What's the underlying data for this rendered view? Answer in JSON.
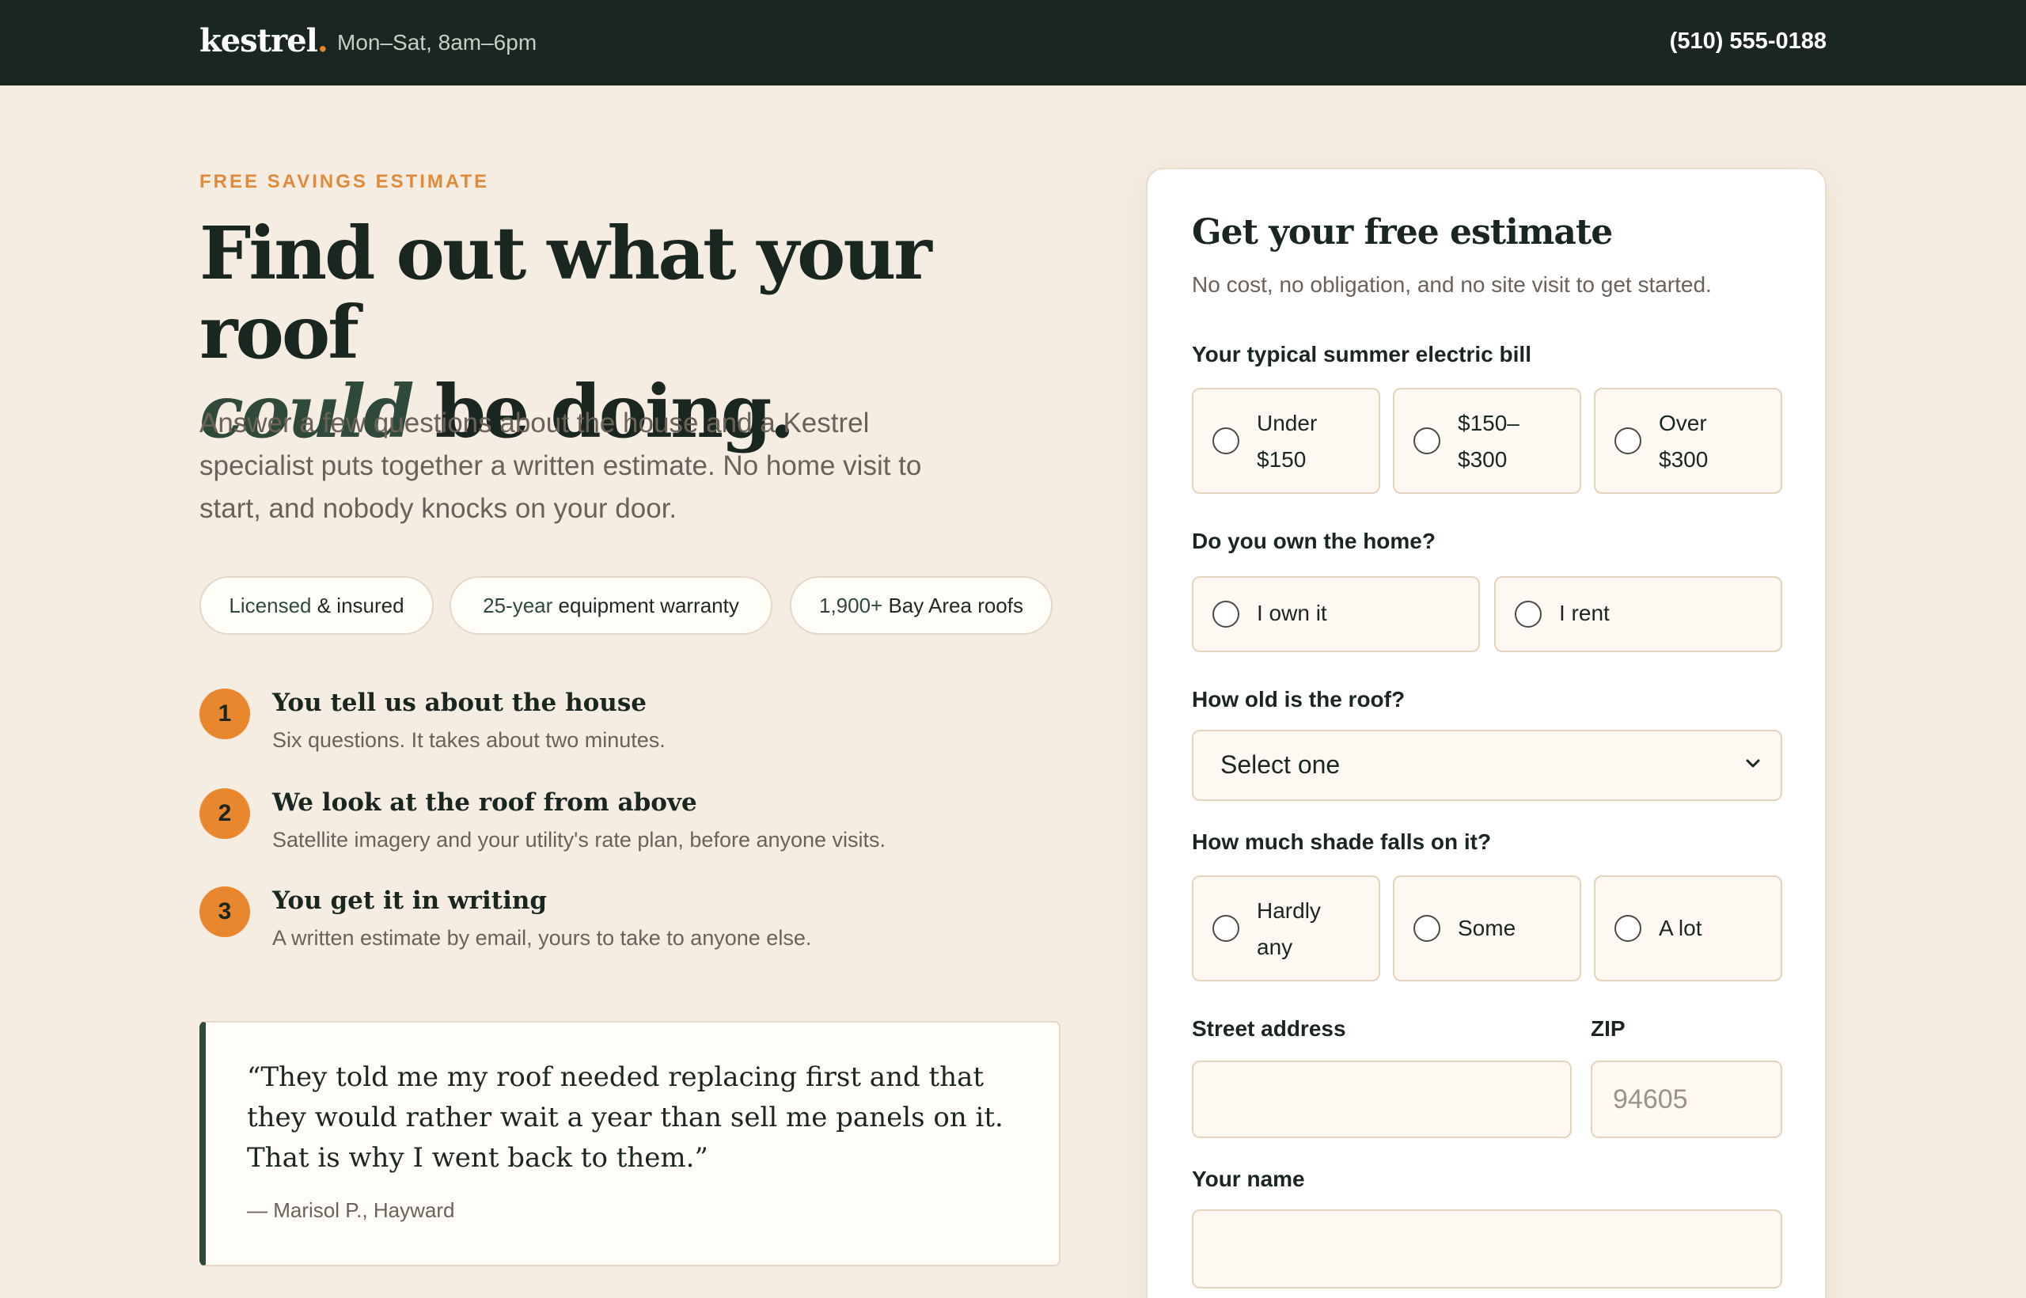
{
  "header": {
    "logo_text": "kestrel",
    "logo_dot": ".",
    "hours": "Mon–Sat, 8am–6pm",
    "phone": "(510) 555-0188"
  },
  "hero": {
    "eyebrow": "FREE SAVINGS ESTIMATE",
    "headline_line1": "Find out what your roof",
    "headline_em": "could",
    "headline_rest": " be doing.",
    "lede": "Answer a few questions about the house and a Kestrel specialist puts together a written estimate. No home visit to start, and nobody knocks on your door."
  },
  "chips": [
    {
      "highlight": "Licensed",
      "text": " & insured"
    },
    {
      "highlight": "25-year",
      "text": " equipment warranty"
    },
    {
      "highlight": "1,900+",
      "text": " Bay Area roofs"
    }
  ],
  "steps": [
    {
      "num": "1",
      "title": "You tell us about the house",
      "desc": "Six questions. It takes about two minutes."
    },
    {
      "num": "2",
      "title": "We look at the roof from above",
      "desc": "Satellite imagery and your utility's rate plan, before anyone visits."
    },
    {
      "num": "3",
      "title": "You get it in writing",
      "desc": "A written estimate by email, yours to take to anyone else."
    }
  ],
  "testimonial": {
    "quote": "“They told me my roof needed replacing first and that they would rather wait a year than sell me panels on it. That is why I went back to them.”",
    "cite": "— Marisol P., Hayward"
  },
  "form": {
    "title": "Get your free estimate",
    "subtitle": "No cost, no obligation, and no site visit to get started.",
    "bill": {
      "label": "Your typical summer electric bill",
      "options": [
        {
          "line1": "Under",
          "line2": "$150"
        },
        {
          "line1": "$150–",
          "line2": "$300"
        },
        {
          "line1": "Over",
          "line2": "$300"
        }
      ]
    },
    "own": {
      "label": "Do you own the home?",
      "options": [
        "I own it",
        "I rent"
      ]
    },
    "roof_age": {
      "label": "How old is the roof?",
      "selected": "Select one"
    },
    "shade": {
      "label": "How much shade falls on it?",
      "options": [
        {
          "line1": "Hardly",
          "line2": "any"
        },
        {
          "line1": "Some",
          "line2": ""
        },
        {
          "line1": "A lot",
          "line2": ""
        }
      ]
    },
    "address": {
      "label": "Street address",
      "value": "",
      "placeholder": ""
    },
    "zip": {
      "label": "ZIP",
      "value": "",
      "placeholder": "94605"
    },
    "name": {
      "label": "Your name",
      "value": "",
      "placeholder": ""
    }
  },
  "colors": {
    "header_bg": "#1a2620",
    "page_bg": "#f6ede2",
    "accent_orange": "#e9872e",
    "forest_green": "#2f4a3a"
  }
}
